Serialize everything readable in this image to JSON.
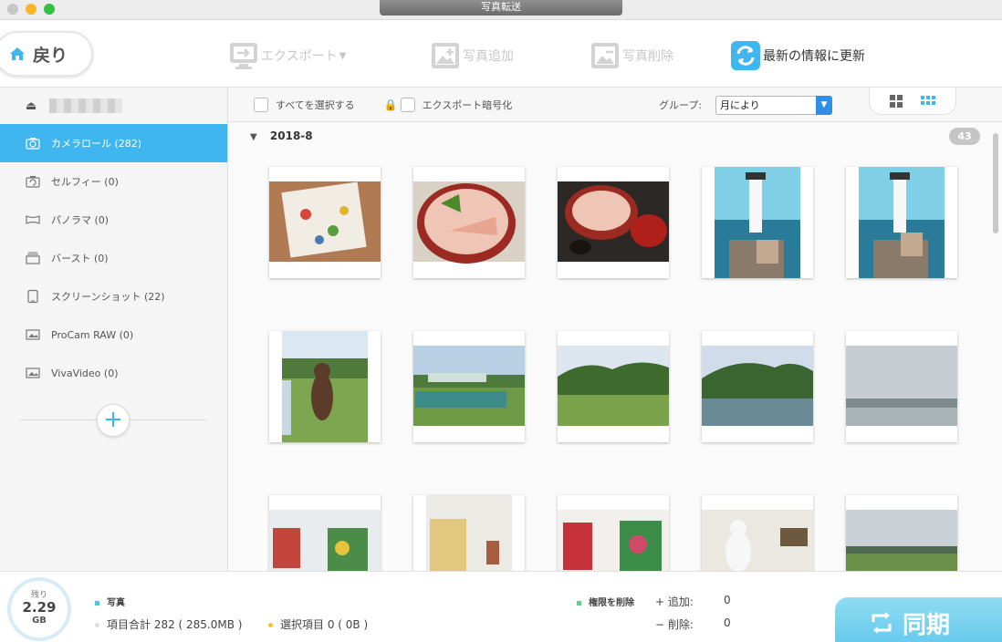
{
  "window": {
    "title": "写真転送"
  },
  "toolbar": {
    "back_label": "戻り",
    "export_label": "エクスポート",
    "add_label": "写真追加",
    "delete_label": "写真削除",
    "refresh_label": "最新の情報に更新"
  },
  "sidebar": {
    "items": [
      {
        "label": "カメラロール (282)",
        "icon": "camera-icon"
      },
      {
        "label": "セルフィー (0)",
        "icon": "selfie-camera-icon"
      },
      {
        "label": "パノラマ (0)",
        "icon": "panorama-icon"
      },
      {
        "label": "バースト (0)",
        "icon": "burst-icon"
      },
      {
        "label": "スクリーンショット (22)",
        "icon": "phone-icon"
      },
      {
        "label": "ProCam RAW (0)",
        "icon": "photo-icon"
      },
      {
        "label": "VivaVideo (0)",
        "icon": "photo-icon"
      }
    ]
  },
  "filter": {
    "select_all_label": "すべてを選択する",
    "encrypt_label": "エクスポート暗号化",
    "group_label": "グループ:",
    "group_value": "月により"
  },
  "content": {
    "group_title": "2018-8",
    "group_count": "43"
  },
  "footer": {
    "remaining_label": "残り",
    "remaining_value": "2.29",
    "remaining_unit": "GB",
    "category_label": "写真",
    "total_label": "項目合計 282 ( 285.0MB )",
    "selected_label": "選択項目 0 ( 0B )",
    "permission_label": "権限を削除",
    "add_label": "追加:",
    "add_value": "0",
    "delete_label": "削除:",
    "delete_value": "0",
    "sync_label": "同期"
  },
  "colors": {
    "accent": "#3fb6f0",
    "sync": "#63c8ec"
  }
}
